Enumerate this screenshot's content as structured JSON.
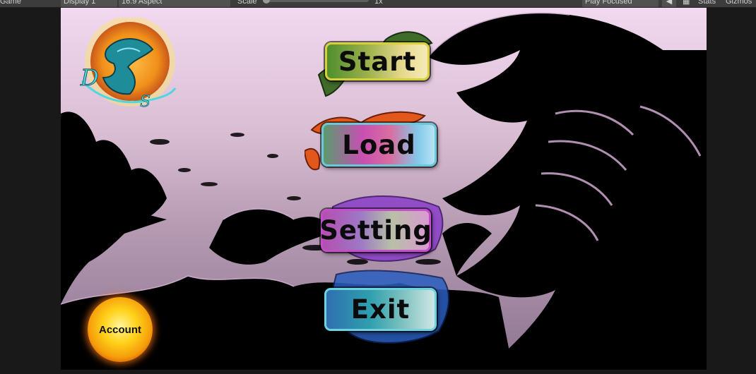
{
  "toolbar": {
    "game_tab": "Game",
    "display": "Display 1",
    "aspect": "16:9 Aspect",
    "scale_label": "Scale",
    "scale_value": "1x",
    "play_mode": "Play Focused",
    "stats": "Stats",
    "gizmos": "Gizmos"
  },
  "menu": {
    "start": "Start",
    "load": "Load",
    "setting": "Setting",
    "exit": "Exit",
    "account": "Account"
  },
  "colors": {
    "sky_top": "#f2d9f0",
    "sky_bottom": "#8d7490",
    "silhouette": "#000000",
    "account_orange": "#f59c0a"
  },
  "icons": {
    "logo": "dragon-logo-icon",
    "mute": "speaker-icon",
    "stats": "grid-icon"
  }
}
